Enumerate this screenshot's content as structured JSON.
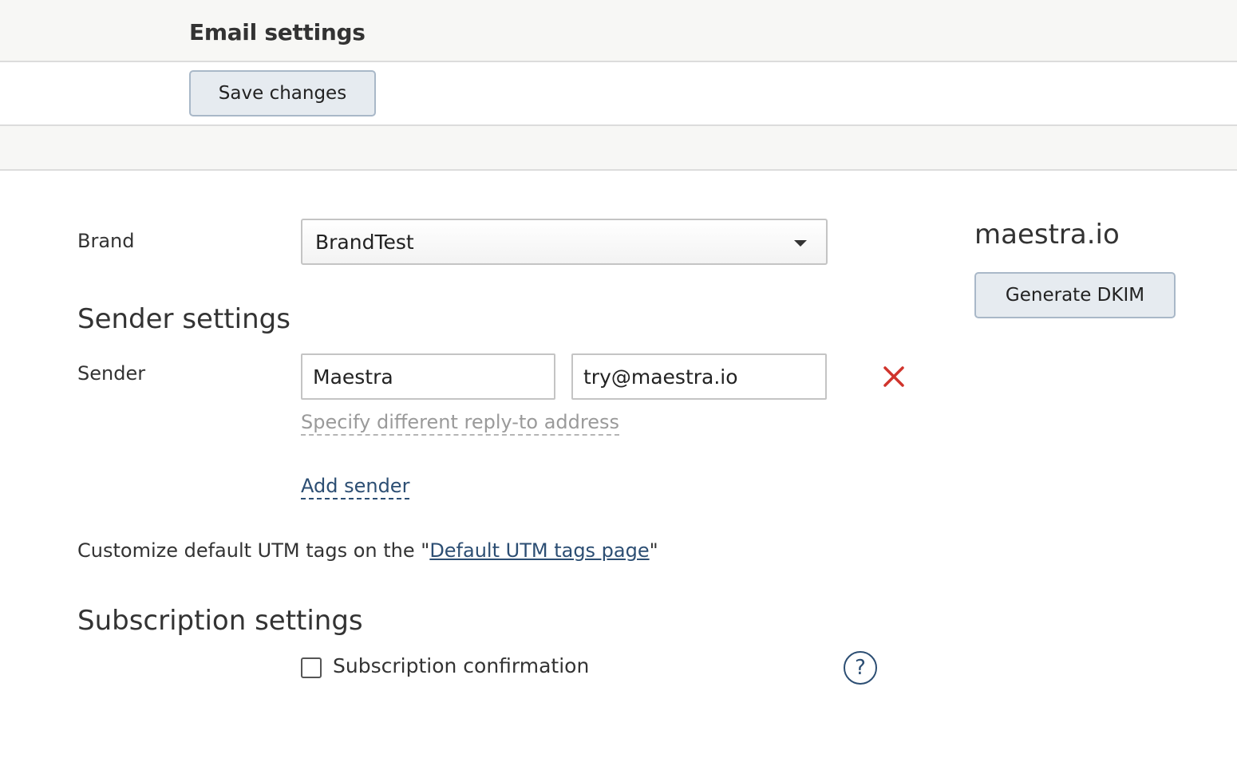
{
  "header": {
    "title": "Email settings"
  },
  "toolbar": {
    "save_label": "Save changes"
  },
  "brand": {
    "label": "Brand",
    "selected": "BrandTest"
  },
  "domain": {
    "name": "maestra.io",
    "generate_label": "Generate DKIM"
  },
  "sender_settings": {
    "title": "Sender settings",
    "sender_label": "Sender",
    "name_value": "Maestra",
    "email_value": "try@maestra.io",
    "reply_to_link": "Specify different reply-to address",
    "add_sender_link": "Add sender"
  },
  "utm": {
    "prefix": "Customize default UTM tags on the \"",
    "link": "Default UTM tags page",
    "suffix": "\""
  },
  "subscription": {
    "title": "Subscription settings",
    "confirmation_label": "Subscription confirmation",
    "confirmation_checked": false,
    "help_glyph": "?"
  },
  "colors": {
    "remove_icon": "#d0342c",
    "link": "#2c4e73",
    "button_bg": "#e6ebf0"
  },
  "icons": {
    "remove": "close-icon",
    "help": "help-icon",
    "dropdown": "chevron-down-icon"
  }
}
